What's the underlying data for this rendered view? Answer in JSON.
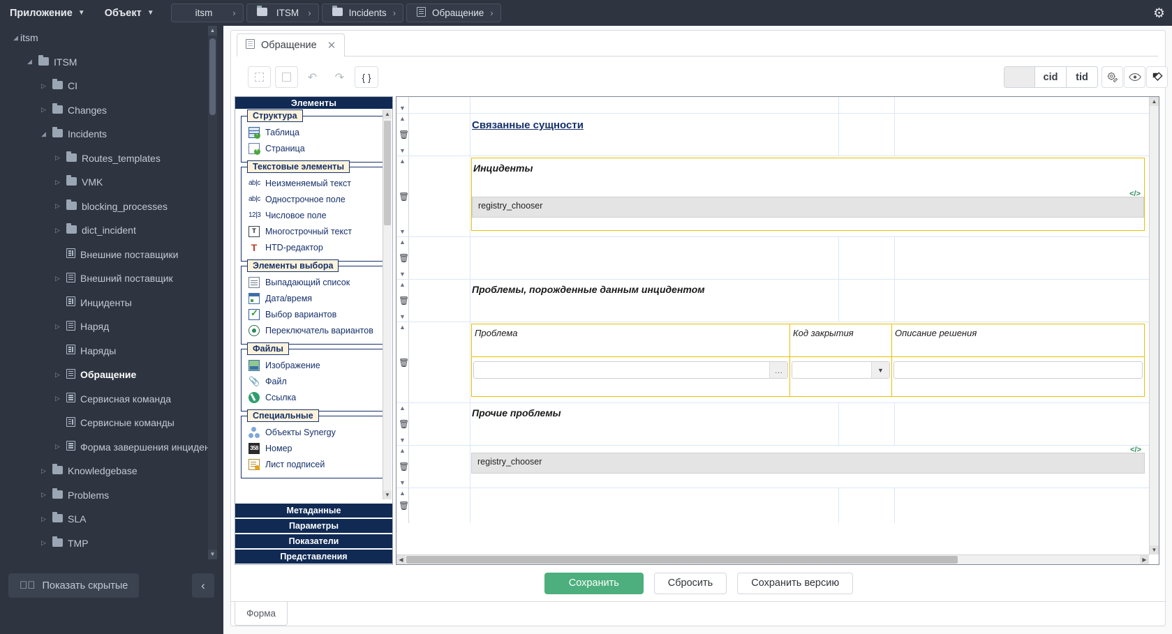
{
  "topbar": {
    "menus": [
      {
        "label": "Приложение",
        "caret": "chevron-down-icon"
      },
      {
        "label": "Объект",
        "caret": "chevron-down-icon"
      }
    ],
    "breadcrumbs": [
      {
        "label": "itsm",
        "icon": "",
        "sep": "›"
      },
      {
        "label": "ITSM",
        "icon": "folder-icon",
        "sep": "›"
      },
      {
        "label": "Incidents",
        "icon": "folder-icon",
        "sep": "›"
      },
      {
        "label": "Обращение",
        "icon": "document-icon",
        "sep": "›"
      }
    ],
    "settings_icon": "⚙"
  },
  "sidebar": {
    "tree": [
      {
        "label": "itsm",
        "indent": 0,
        "arrow": "down",
        "icon": "none"
      },
      {
        "label": "ITSM",
        "indent": 1,
        "arrow": "down",
        "icon": "folder"
      },
      {
        "label": "CI",
        "indent": 2,
        "arrow": "right",
        "icon": "folder"
      },
      {
        "label": "Changes",
        "indent": 2,
        "arrow": "right",
        "icon": "folder"
      },
      {
        "label": "Incidents",
        "indent": 2,
        "arrow": "down",
        "icon": "folder"
      },
      {
        "label": "Routes_templates",
        "indent": 3,
        "arrow": "right",
        "icon": "folder"
      },
      {
        "label": "VMK",
        "indent": 3,
        "arrow": "right",
        "icon": "folder"
      },
      {
        "label": "blocking_processes",
        "indent": 3,
        "arrow": "right",
        "icon": "folder"
      },
      {
        "label": "dict_incident",
        "indent": 3,
        "arrow": "right",
        "icon": "folder"
      },
      {
        "label": "Внешние поставщики",
        "indent": 3,
        "arrow": "none",
        "icon": "registry"
      },
      {
        "label": "Внешний поставщик",
        "indent": 3,
        "arrow": "right",
        "icon": "doc"
      },
      {
        "label": "Инциденты",
        "indent": 3,
        "arrow": "none",
        "icon": "registry"
      },
      {
        "label": "Наряд",
        "indent": 3,
        "arrow": "right",
        "icon": "doc"
      },
      {
        "label": "Наряды",
        "indent": 3,
        "arrow": "none",
        "icon": "registry"
      },
      {
        "label": "Обращение",
        "indent": 3,
        "arrow": "right",
        "icon": "doc",
        "selected": true
      },
      {
        "label": "Сервисная команда",
        "indent": 3,
        "arrow": "right",
        "icon": "doc"
      },
      {
        "label": "Сервисные команды",
        "indent": 3,
        "arrow": "none",
        "icon": "registry"
      },
      {
        "label": "Форма завершения инцидента",
        "indent": 3,
        "arrow": "right",
        "icon": "doc"
      },
      {
        "label": "Knowledgebase",
        "indent": 2,
        "arrow": "right",
        "icon": "folder"
      },
      {
        "label": "Problems",
        "indent": 2,
        "arrow": "right",
        "icon": "folder"
      },
      {
        "label": "SLA",
        "indent": 2,
        "arrow": "right",
        "icon": "folder"
      },
      {
        "label": "TMP",
        "indent": 2,
        "arrow": "right",
        "icon": "folder"
      }
    ],
    "show_hidden_label": "Показать скрытые",
    "show_hidden_icon": "eye-slash-icon",
    "collapse_icon": "‹"
  },
  "editor": {
    "doc_tab": {
      "label": "Обращение",
      "icon": "document-icon",
      "close": "✕"
    },
    "toolbar": {
      "grid_icon": "grid-icon",
      "square_icon": "square-icon",
      "undo_icon": "↶",
      "redo_icon": "↷",
      "json_label": "{ }",
      "blank_label": "",
      "cid_label": "cid",
      "tid_label": "tid",
      "gear_icon": "settings-wrench-icon",
      "eye_icon": "preview-eye-icon",
      "edit_icon": "edit-pencil-icon"
    },
    "buttons": {
      "save": "Сохранить",
      "reset": "Сбросить",
      "save_version": "Сохранить версию"
    },
    "bottom_tab": "Форма"
  },
  "palette": {
    "header": "Элементы",
    "groups": [
      {
        "legend": "Структура",
        "items": [
          {
            "label": "Таблица",
            "icon": "table-icon"
          },
          {
            "label": "Страница",
            "icon": "page-icon"
          }
        ]
      },
      {
        "legend": "Текстовые элементы",
        "items": [
          {
            "label": "Неизменяемый текст",
            "icon": "abc-icon"
          },
          {
            "label": "Однострочное поле",
            "icon": "abc-icon"
          },
          {
            "label": "Числовое поле",
            "icon": "number-123-icon"
          },
          {
            "label": "Многострочный текст",
            "icon": "textarea-icon"
          },
          {
            "label": "HTD-редактор",
            "icon": "htd-editor-icon"
          }
        ]
      },
      {
        "legend": "Элементы выбора",
        "items": [
          {
            "label": "Выпадающий список",
            "icon": "dropdown-icon"
          },
          {
            "label": "Дата/время",
            "icon": "calendar-icon"
          },
          {
            "label": "Выбор вариантов",
            "icon": "checkbox-icon"
          },
          {
            "label": "Переключатель вариантов",
            "icon": "radio-icon"
          }
        ]
      },
      {
        "legend": "Файлы",
        "items": [
          {
            "label": "Изображение",
            "icon": "image-icon"
          },
          {
            "label": "Файл",
            "icon": "paperclip-icon"
          },
          {
            "label": "Ссылка",
            "icon": "link-icon"
          }
        ]
      },
      {
        "legend": "Специальные",
        "items": [
          {
            "label": "Объекты Synergy",
            "icon": "synergy-objects-icon"
          },
          {
            "label": "Номер",
            "icon": "number-icon",
            "glyph": "358"
          },
          {
            "label": "Лист подписей",
            "icon": "signature-sheet-icon"
          }
        ]
      }
    ],
    "accordion": [
      "Метаданные",
      "Параметры",
      "Показатели",
      "Представления"
    ]
  },
  "form": {
    "section_title": "Связанные сущности",
    "incidents_label": "Инциденты",
    "incidents_chooser": "registry_chooser",
    "problems_label": "Проблемы, порожденные данным инцидентом",
    "table_headers": {
      "problem": "Проблема",
      "close_code": "Код закрытия",
      "solution": "Описание решения"
    },
    "table_inputs": {
      "problem_value": "",
      "problem_button": "…",
      "close_code_value": "",
      "close_code_caret": "▼",
      "solution_value": ""
    },
    "other_problems_label": "Прочие проблемы",
    "other_problems_chooser": "registry_chooser",
    "code_marker": "</>"
  },
  "colors": {
    "topbar_bg": "#2e3440",
    "sidebar_bg": "#2e3440",
    "accent_navy": "#102a54",
    "save_green": "#4caf7d",
    "yellow_border": "#e8c000"
  }
}
